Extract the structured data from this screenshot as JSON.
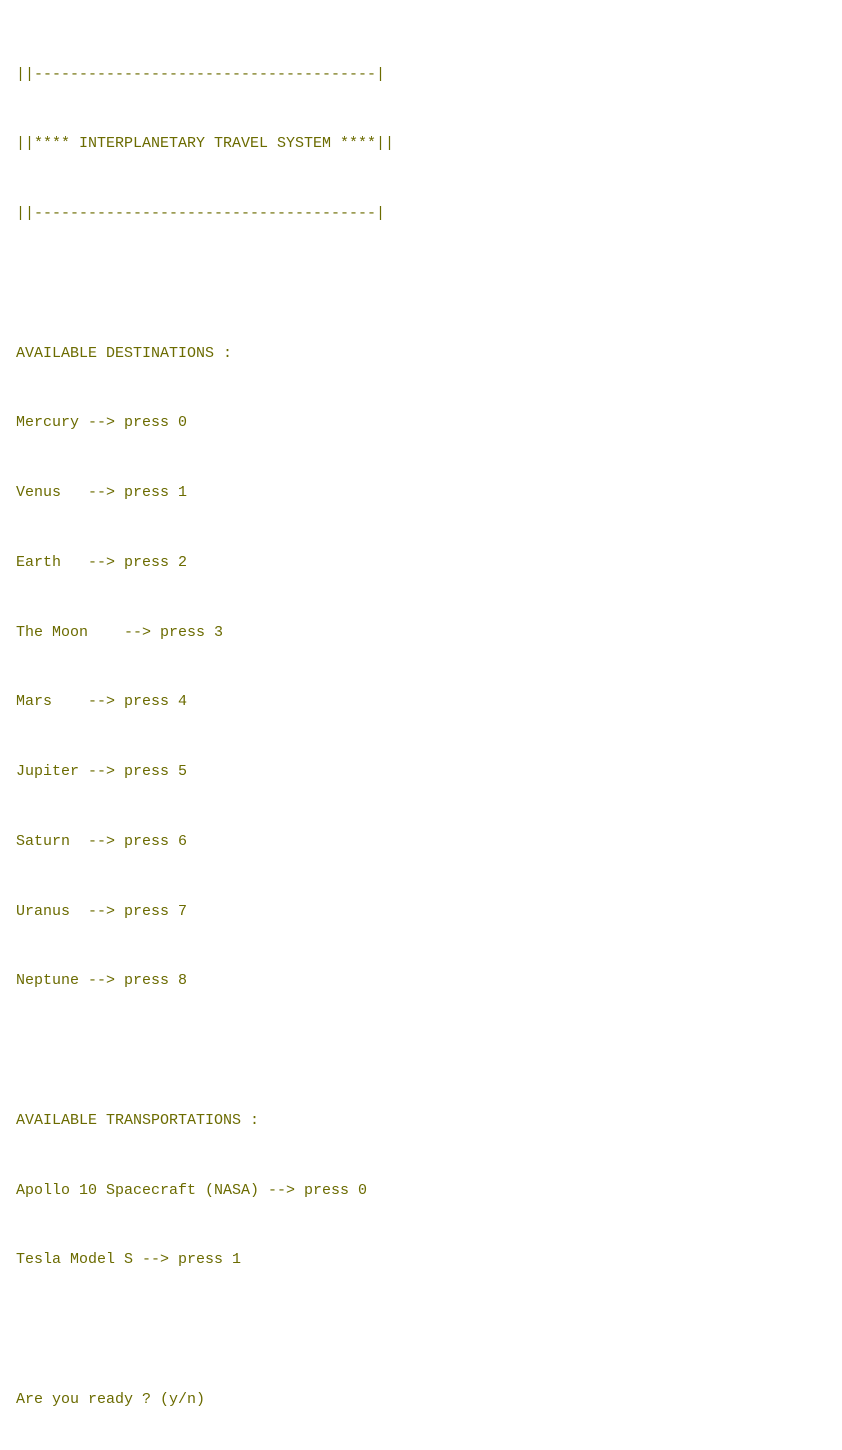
{
  "terminal": {
    "border_top": "||--------------------------------------|",
    "title_line": "||**** INTERPLANETARY TRAVEL SYSTEM ****||",
    "border_bottom": "||--------------------------------------|",
    "destinations_header": "AVAILABLE DESTINATIONS :",
    "destinations": [
      "Mercury --> press 0",
      "Venus   --> press 1",
      "Earth   --> press 2",
      "The Moon    --> press 3",
      "Mars    --> press 4",
      "Jupiter --> press 5",
      "Saturn  --> press 6",
      "Uranus  --> press 7",
      "Neptune --> press 8"
    ],
    "transportations_header": "AVAILABLE TRANSPORTATIONS :",
    "transportations": [
      "Apollo 10 Spacecraft (NASA) --> press 0",
      "Tesla Model S --> press 1"
    ],
    "prompt": "Are you ready ? (y/n)"
  }
}
